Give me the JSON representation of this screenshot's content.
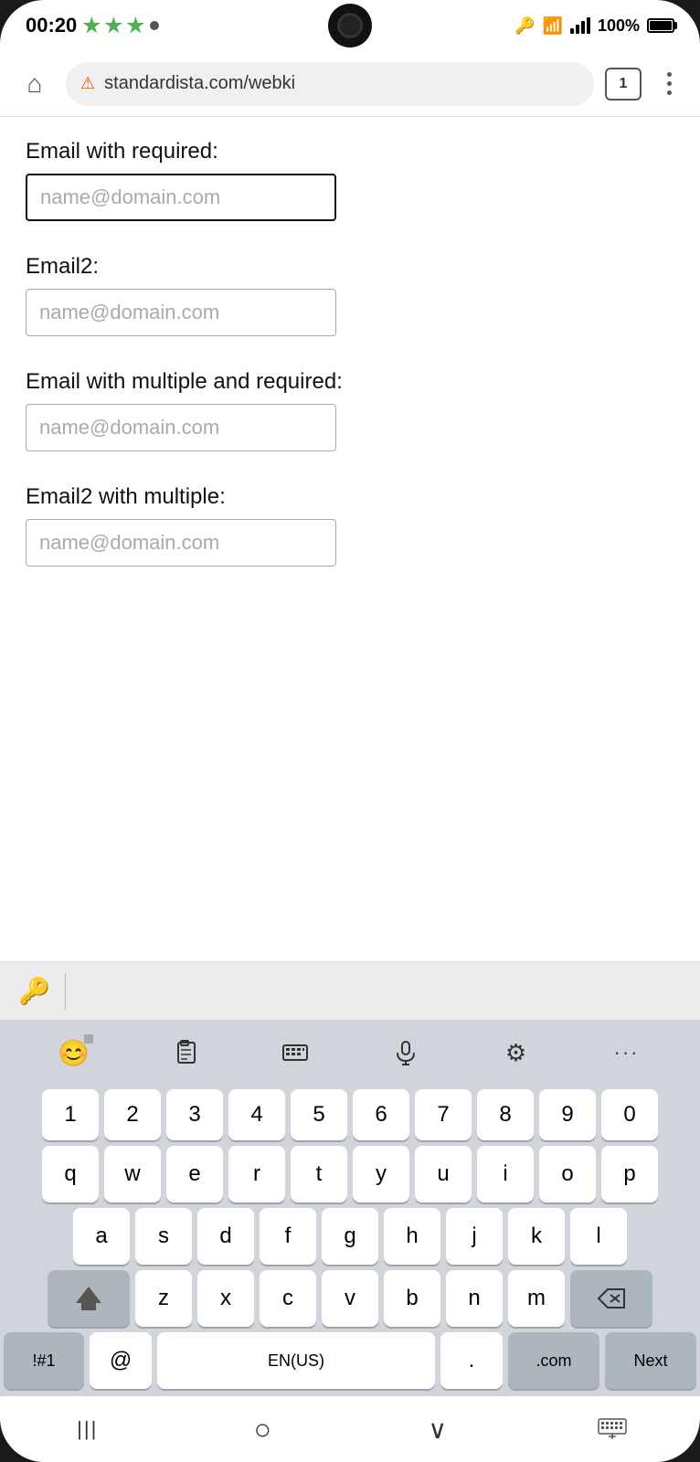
{
  "status_bar": {
    "time": "00:20",
    "battery": "100%",
    "dot": "•"
  },
  "browser": {
    "url": "standardista.com/webki",
    "tab_count": "1"
  },
  "form": {
    "field1": {
      "label": "Email with required:",
      "placeholder": "name@domain.com",
      "border_style": "focused"
    },
    "field2": {
      "label": "Email2:",
      "placeholder": "name@domain.com",
      "border_style": "thin"
    },
    "field3": {
      "label": "Email with multiple and required:",
      "placeholder": "name@domain.com",
      "border_style": "normal"
    },
    "field4": {
      "label": "Email2 with multiple:",
      "placeholder": "name@domain.com",
      "border_style": "normal"
    }
  },
  "keyboard_toolbar": {
    "emoji_icon": "😊",
    "clipboard_icon": "📋",
    "keyboard_icon": "⌨",
    "mic_icon": "🎤",
    "settings_icon": "⚙",
    "more_icon": "···"
  },
  "keyboard_rows": {
    "numbers": [
      "1",
      "2",
      "3",
      "4",
      "5",
      "6",
      "7",
      "8",
      "9",
      "0"
    ],
    "row1": [
      "q",
      "w",
      "e",
      "r",
      "t",
      "y",
      "u",
      "i",
      "o",
      "p"
    ],
    "row2": [
      "a",
      "s",
      "d",
      "f",
      "g",
      "h",
      "j",
      "k",
      "l"
    ],
    "row3": [
      "z",
      "x",
      "c",
      "v",
      "b",
      "n",
      "m"
    ],
    "bottom": {
      "symbols": "!#1",
      "at": "@",
      "space": "EN(US)",
      "period": ".",
      "dotcom": ".com",
      "next": "Next"
    }
  },
  "nav_bar": {
    "back_icon": "|||",
    "home_icon": "○",
    "down_icon": "∨",
    "keyboard_icon": "⌨"
  }
}
